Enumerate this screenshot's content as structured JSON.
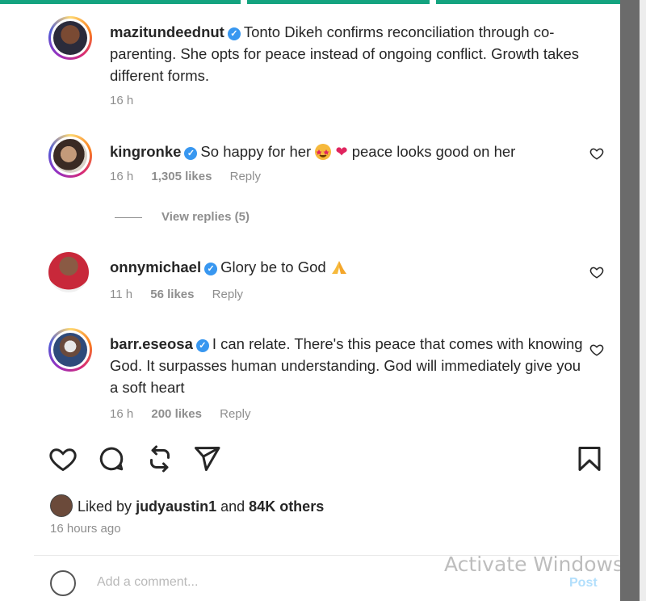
{
  "comments": [
    {
      "username": "mazitundeednut",
      "text": "Tonto Dikeh confirms reconciliation through co-parenting. She opts for peace instead of ongoing conflict. Growth takes different forms.",
      "time": "16 h"
    },
    {
      "username": "kingronke",
      "text_before": "So happy for her",
      "text_after": "peace looks good on her",
      "time": "16 h",
      "likes": "1,305 likes",
      "reply": "Reply"
    },
    {
      "username": "onnymichael",
      "text": "Glory be to God",
      "time": "11 h",
      "likes": "56 likes",
      "reply": "Reply"
    },
    {
      "username": "barr.eseosa",
      "text": "I can relate. There's this peace that comes with knowing God. It surpasses human understanding. God will immediately give you a soft heart",
      "time": "16 h",
      "likes": "200 likes",
      "reply": "Reply"
    }
  ],
  "view_replies": "View replies (5)",
  "liked_by": {
    "prefix": "Liked by",
    "user": "judyaustin1",
    "and": "and",
    "others": "84K others"
  },
  "time_ago": "16 hours ago",
  "add_comment_placeholder": "Add a comment...",
  "post_label": "Post",
  "watermark": "Activate Windows",
  "icons": [
    "heart-icon",
    "comment-icon",
    "repost-icon",
    "share-icon",
    "bookmark-icon",
    "verified-icon",
    "emoji-icon"
  ],
  "colors": {
    "verified": "#3897f0",
    "progress": "#14a37f",
    "muted": "#8e8e8e"
  }
}
